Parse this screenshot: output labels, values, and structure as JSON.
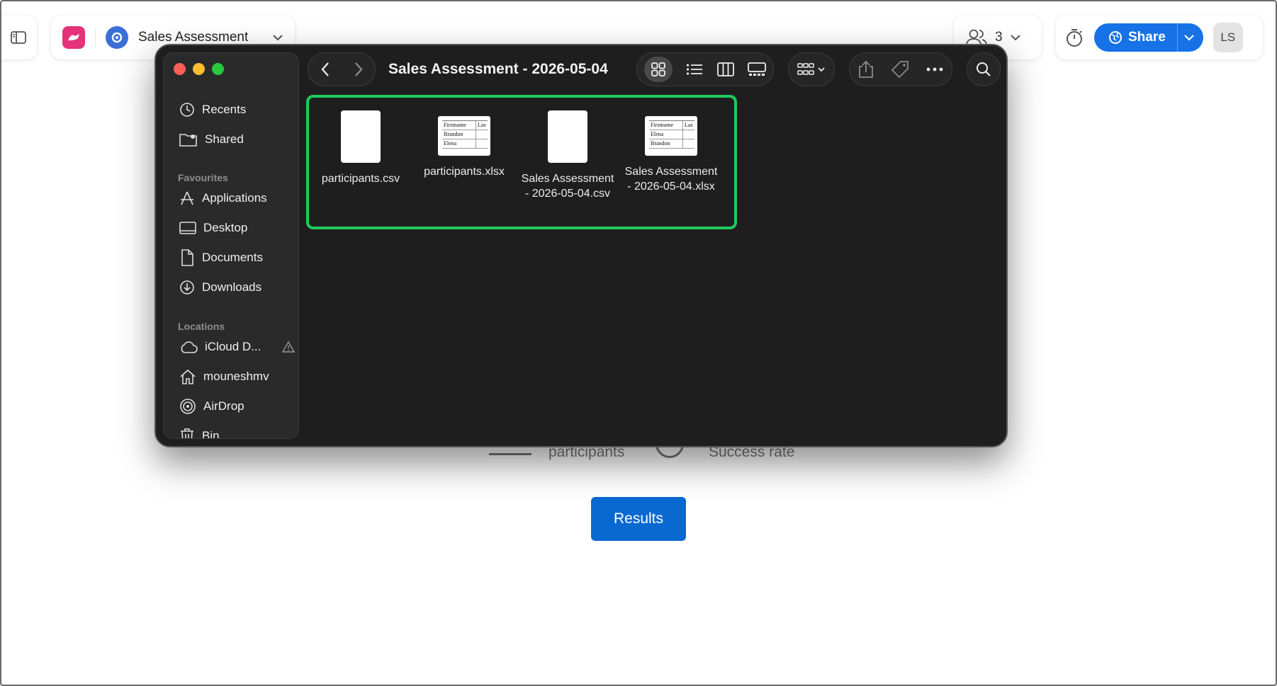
{
  "app": {
    "document_title": "Sales Assessment",
    "collaborators_count": "3",
    "share_label": "Share",
    "avatar_initials": "LS",
    "brand_color": "#e4327b",
    "share_color": "#1672e6"
  },
  "page": {
    "stat_participants_label": "participants",
    "stat_success_label": "Success rate",
    "results_label": "Results",
    "results_color": "#0a68d1"
  },
  "finder": {
    "window_title": "Sales Assessment - 2026-05-04",
    "sidebar": {
      "recents": "Recents",
      "shared": "Shared",
      "favourites_header": "Favourites",
      "applications": "Applications",
      "desktop": "Desktop",
      "documents": "Documents",
      "downloads": "Downloads",
      "locations_header": "Locations",
      "icloud": "iCloud D...",
      "home": "mouneshmv",
      "airdrop": "AirDrop",
      "bin": "Bin"
    },
    "toolbar_icons": [
      "back-icon",
      "forward-icon",
      "icon-view-icon",
      "list-view-icon",
      "column-view-icon",
      "gallery-view-icon",
      "group-by-icon",
      "share-icon",
      "tag-icon",
      "more-icon",
      "search-icon"
    ],
    "highlight_color": "#1fca5c",
    "files": [
      {
        "name": "participants.csv",
        "kind": "csv"
      },
      {
        "name": "participants.xlsx",
        "kind": "xlsx",
        "preview_header": [
          "Firstname",
          "Lastn"
        ],
        "preview_rows": [
          "Brandon",
          "Elena"
        ]
      },
      {
        "name": "Sales Assessment - 2026-05-04.csv",
        "line1": "Sales Assessment",
        "line2": "- 2026-05-04.csv",
        "kind": "csv"
      },
      {
        "name": "Sales Assessment - 2026-05-04.xlsx",
        "line1": "Sales Assessment",
        "line2": "- 2026-05-04.xlsx",
        "kind": "xlsx",
        "preview_header": [
          "Firstname",
          "Lastn"
        ],
        "preview_rows": [
          "Elena",
          "Brandon"
        ]
      }
    ]
  }
}
